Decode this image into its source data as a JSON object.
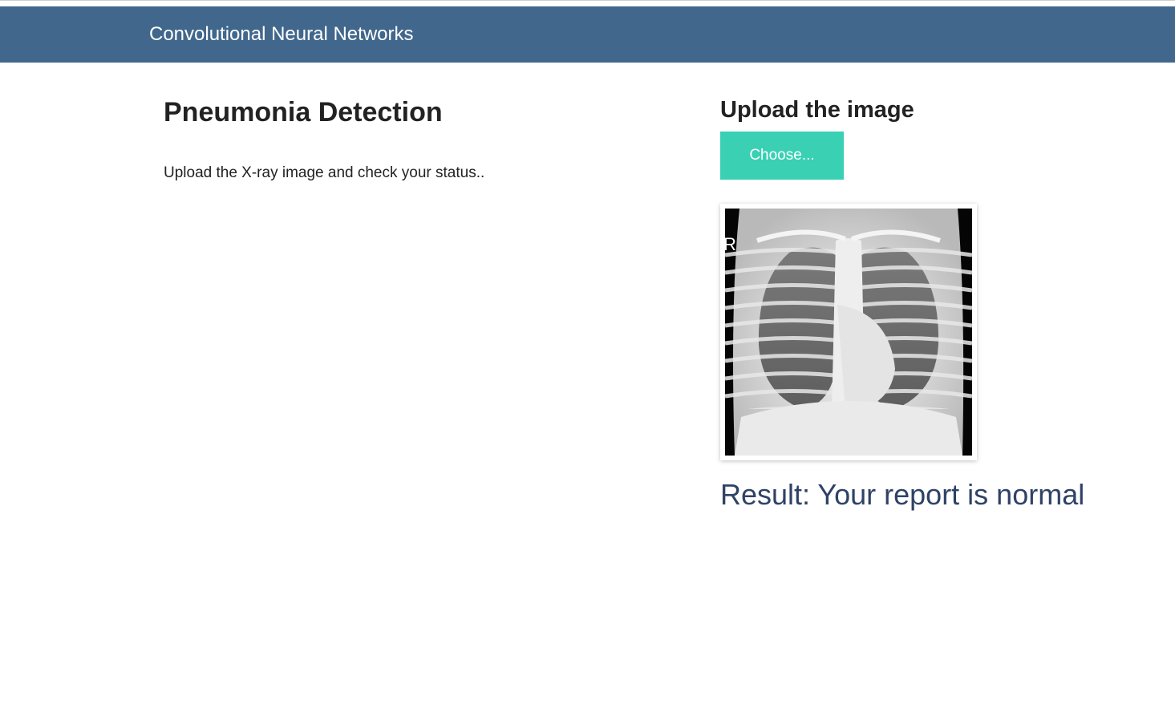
{
  "navbar": {
    "brand": "Convolutional Neural Networks"
  },
  "intro": {
    "title": "Pneumonia Detection",
    "description": "Upload the X-ray image and check your status.."
  },
  "upload": {
    "heading": "Upload the image",
    "choose_button": "Choose...",
    "preview_marker": "R"
  },
  "result": {
    "text": "Result: Your report is normal"
  },
  "colors": {
    "navbar_bg": "#41678c",
    "button_bg": "#39d0b4",
    "result_text": "#2f4266"
  }
}
